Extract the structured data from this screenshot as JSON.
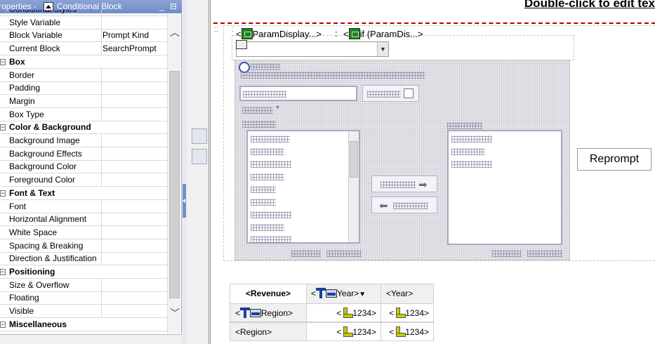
{
  "panel": {
    "title_prefix": "roperties - ",
    "title_object": "Conditional Block",
    "minimize": "_",
    "restore": "⊟",
    "rows": [
      {
        "label": "Conditional Styles",
        "value": "",
        "cat": false
      },
      {
        "label": "Style Variable",
        "value": "",
        "cat": false
      },
      {
        "label": "Block Variable",
        "value": "Prompt Kind",
        "cat": false
      },
      {
        "label": "Current Block",
        "value": "SearchPrompt",
        "cat": false
      },
      {
        "label": "Box",
        "value": "",
        "cat": true
      },
      {
        "label": "Border",
        "value": "",
        "cat": false
      },
      {
        "label": "Padding",
        "value": "",
        "cat": false
      },
      {
        "label": "Margin",
        "value": "",
        "cat": false
      },
      {
        "label": "Box Type",
        "value": "",
        "cat": false
      },
      {
        "label": "Color & Background",
        "value": "",
        "cat": true
      },
      {
        "label": "Background Image",
        "value": "",
        "cat": false
      },
      {
        "label": "Background Effects",
        "value": "",
        "cat": false
      },
      {
        "label": "Background Color",
        "value": "",
        "cat": false
      },
      {
        "label": "Foreground Color",
        "value": "",
        "cat": false
      },
      {
        "label": "Font & Text",
        "value": "",
        "cat": true
      },
      {
        "label": "Font",
        "value": "",
        "cat": false
      },
      {
        "label": "Horizontal Alignment",
        "value": "",
        "cat": false
      },
      {
        "label": "White Space",
        "value": "",
        "cat": false
      },
      {
        "label": "Spacing & Breaking",
        "value": "",
        "cat": false
      },
      {
        "label": "Direction & Justification",
        "value": "",
        "cat": false
      },
      {
        "label": "Positioning",
        "value": "",
        "cat": true
      },
      {
        "label": "Size & Overflow",
        "value": "",
        "cat": false
      },
      {
        "label": "Floating",
        "value": "",
        "cat": false
      },
      {
        "label": "Visible",
        "value": "",
        "cat": false
      },
      {
        "label": "Miscellaneous",
        "value": "",
        "cat": true
      }
    ]
  },
  "canvas": {
    "title": "Double-click to edit tex",
    "param_display": "ParamDisplay...>",
    "param_display_open": "<",
    "colon": ":",
    "if_param": "if (ParamDis...>",
    "if_open": "<",
    "reprompt": "Reprompt"
  },
  "crosstab": {
    "corner": "<Revenue>",
    "col_header": "Year>",
    "col_header_open": "<",
    "col_header2": "<Year>",
    "row_header": "Region>",
    "row_header_open": "<",
    "row_header2": "<Region>",
    "cell_open": "<",
    "cell_value": "1234>"
  }
}
